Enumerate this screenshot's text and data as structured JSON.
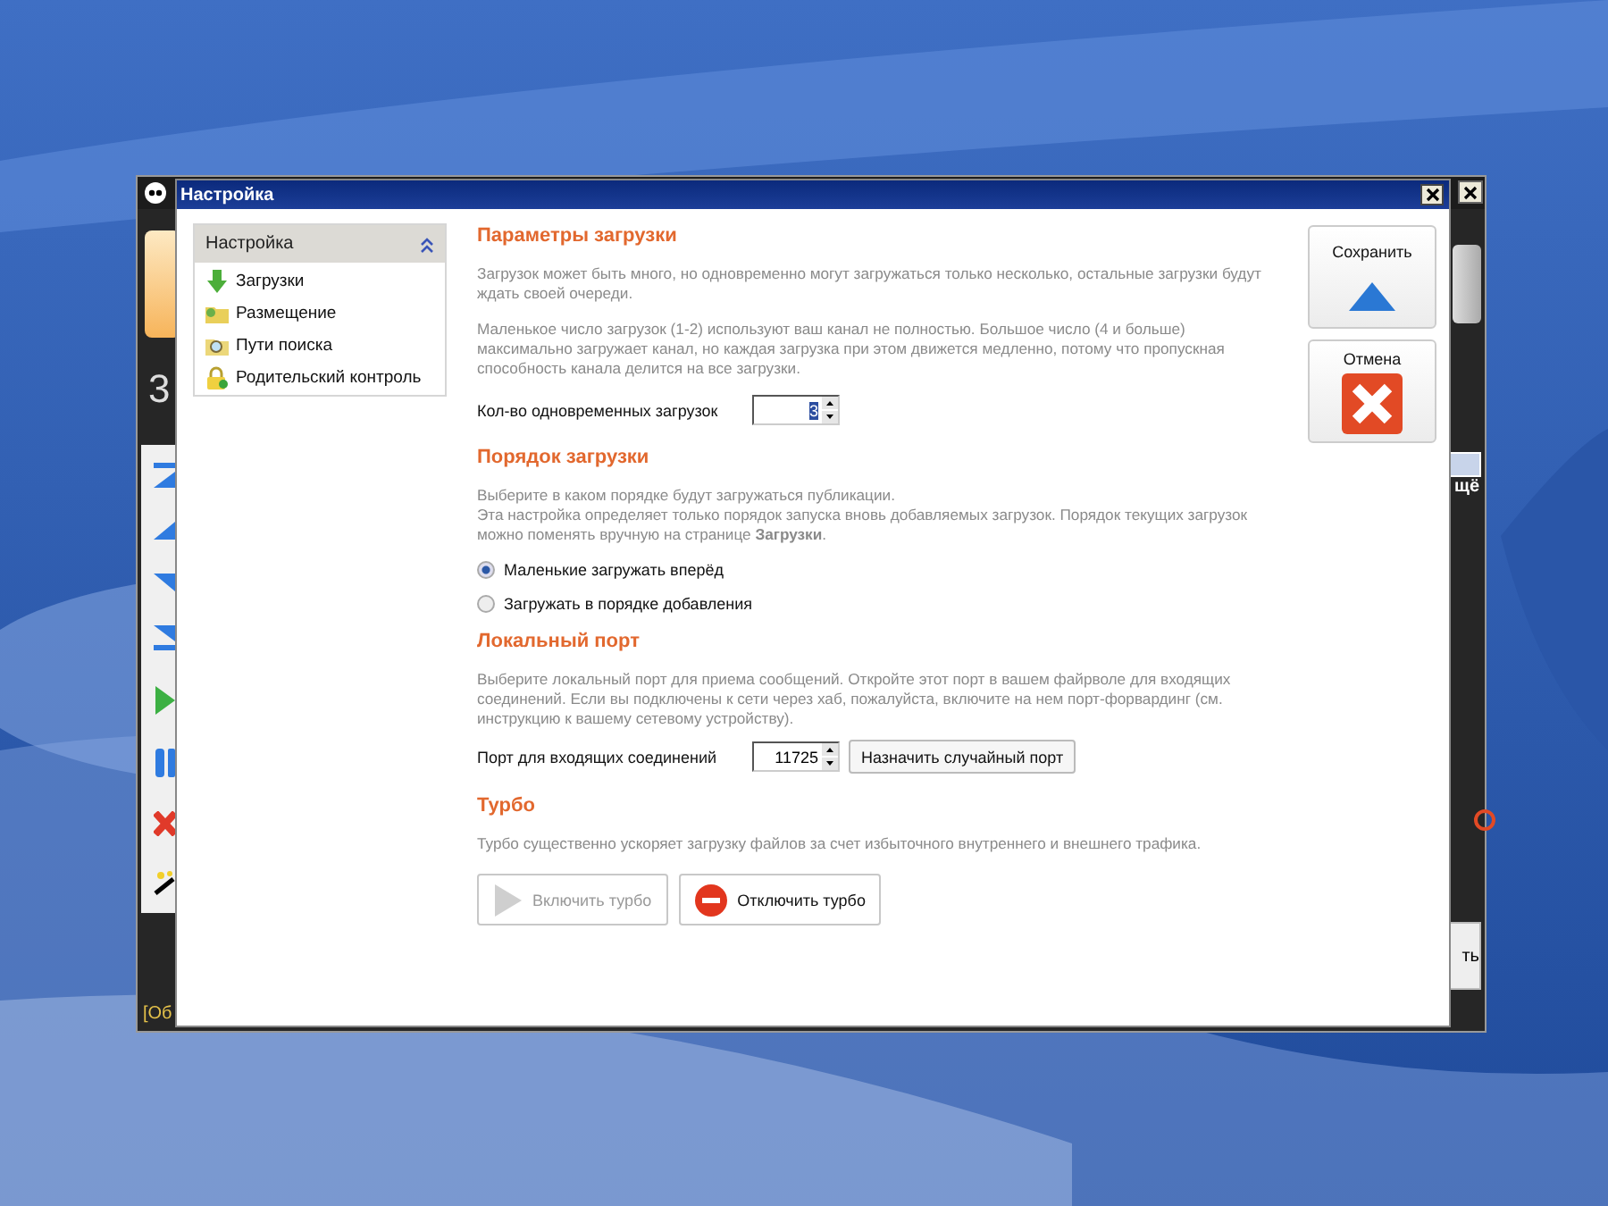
{
  "background_app": {
    "digit": "3",
    "right_label": "щё",
    "right_button": "ть",
    "status_text": "[Об"
  },
  "dialog": {
    "title": "Настройка"
  },
  "sidebar": {
    "header": "Настройка",
    "items": [
      {
        "label": "Загрузки",
        "kind": "download"
      },
      {
        "label": "Размещение",
        "kind": "folder"
      },
      {
        "label": "Пути поиска",
        "kind": "search"
      },
      {
        "label": "Родительский контроль",
        "kind": "lock"
      }
    ]
  },
  "download_params": {
    "title": "Параметры загрузки",
    "paragraphs": [
      "Загрузок может быть много, но одновременно могут загружаться только несколько, остальные загрузки будут ждать своей очереди.",
      "Маленькое число загрузок (1-2)  используют ваш канал не полностью. Большое число (4 и больше) максимально загружает канал, но каждая загрузка при этом движется медленно, потому что пропускная способность канала делится на все загрузки."
    ],
    "count_label": "Кол-во одновременных загрузок",
    "count_value": "3"
  },
  "download_order": {
    "title": "Порядок загрузки",
    "lines": [
      "Выберите в каком порядке будут загружаться публикации.",
      "Эта настройка определяет только порядок запуска вновь добавляемых загрузок. Порядок текущих загрузок можно поменять вручную на странице **Загрузки**."
    ],
    "options": [
      {
        "label": "Маленькие загружать вперёд",
        "selected": true
      },
      {
        "label": "Загружать в порядке добавления",
        "selected": false
      }
    ]
  },
  "local_port": {
    "title": "Локальный порт",
    "text": "Выберите локальный порт для приема сообщений. Откройте этот порт в вашем файрволе для входящих соединений. Если вы подключены к сети через хаб, пожалуйста, включите на нем порт-форвардинг (см. инструкцию к вашему сетевому устройству).",
    "port_label": "Порт для входящих соединений",
    "port_value": "11725",
    "random_button": "Назначить случайный порт"
  },
  "turbo": {
    "title": "Турбо",
    "text": "Турбо существенно ускоряет загрузку файлов за счет избыточного внутреннего и внешнего трафика.",
    "buttons": [
      {
        "label": "Включить турбо",
        "kind": "on",
        "disabled": true
      },
      {
        "label": "Отключить турбо",
        "kind": "off",
        "disabled": false
      }
    ]
  },
  "actions": [
    {
      "label": "Сохранить",
      "kind": "save"
    },
    {
      "label": "Отмена",
      "kind": "cancel"
    }
  ]
}
